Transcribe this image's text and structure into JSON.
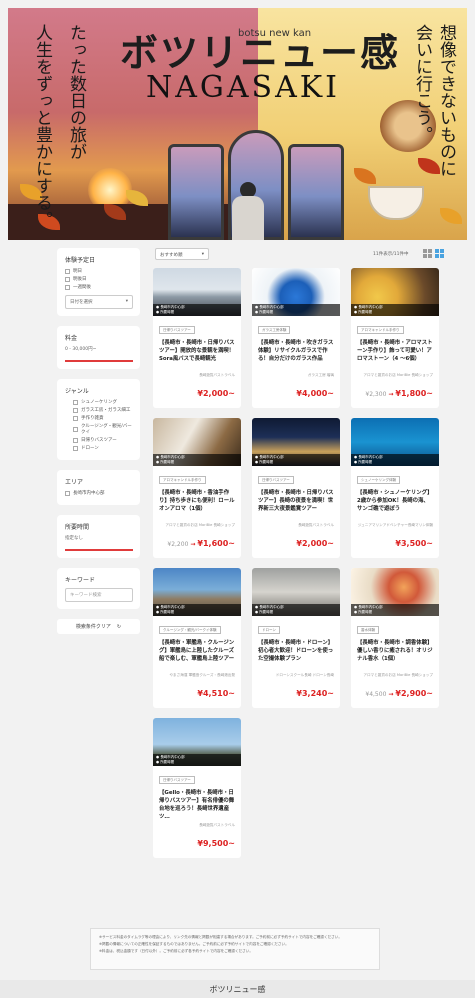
{
  "hero": {
    "logo_katakana": "ボツリニュー感",
    "logo_romaji": "botsu new kan",
    "city": "NAGASAKI",
    "tagline_left_1": "たった数日の旅が",
    "tagline_left_2": "人生をずっと豊かにする。",
    "tagline_right_1": "想像できないものに",
    "tagline_right_2": "会いに行こう。"
  },
  "sidebar": {
    "date": {
      "heading": "体験予定日",
      "options": [
        "明日",
        "明後日",
        "一週間後"
      ],
      "select_label": "日付を選択"
    },
    "price": {
      "heading": "料金",
      "range": "0 - 30,000円~"
    },
    "genre": {
      "heading": "ジャンル",
      "options": [
        "シュノーケリング",
        "ガラス工房・ガラス細工",
        "手作り雑貨",
        "クルージング・観光/バークイ",
        "日帰りバスツアー",
        "ドローン"
      ]
    },
    "area": {
      "heading": "エリア",
      "options": [
        "長崎市内中心部"
      ]
    },
    "duration": {
      "heading": "所要時間",
      "value": "指定なし"
    },
    "keyword": {
      "heading": "キーワード",
      "placeholder": "キーワード検索"
    },
    "clear_label": "検索条件クリア"
  },
  "toolbar": {
    "sort_label": "おすすめ順",
    "count_label": "11件表示/11件中"
  },
  "cards": [
    {
      "meta1": "長崎市内中心部",
      "meta2": "所要時間",
      "tag": "日帰りバスツアー",
      "name": "【長崎市・長崎市・日帰りバスツアー】開放的な景観を満喫！Sora風バスで長崎観光",
      "provider": "長崎遊覧バストラベル",
      "old_price": "",
      "price": "¥2,000~"
    },
    {
      "meta1": "長崎市内中心部",
      "meta2": "所要時間",
      "tag": "ガラス工房体験",
      "name": "【長崎市・長崎市・吹きガラス体験】リサイクルガラスで作る！自分だけのガラス作品",
      "provider": "ガラス工房 瑠璃",
      "old_price": "",
      "price": "¥4,000~"
    },
    {
      "meta1": "長崎市内中心部",
      "meta2": "所要時間",
      "tag": "アロマキャンドル手作り",
      "name": "【長崎市・長崎市・アロマストーン手作り】飾って可愛い！アロマストーン（4 ～6個）",
      "provider": "アロマと雑貨のお店 MoriBie 長崎ショップ",
      "old_price": "¥2,300",
      "price": "¥1,800~"
    },
    {
      "meta1": "長崎市内中心部",
      "meta2": "所要時間",
      "tag": "アロマキャンドル手作り",
      "name": "【長崎市・長崎市・香油手作り】持ち歩きにも便利！ロールオンアロマ（1個）",
      "provider": "アロマと雑貨のお店 MoriBie 長崎ショップ",
      "old_price": "¥2,200",
      "price": "¥1,600~"
    },
    {
      "meta1": "長崎市内中心部",
      "meta2": "所要時間",
      "tag": "日帰りバスツアー",
      "name": "【長崎市・長崎市・日帰りバスツアー】長崎の夜景を満喫！世界新三大夜景鑑賞ツアー",
      "provider": "長崎遊覧バストラベル",
      "old_price": "",
      "price": "¥2,000~"
    },
    {
      "meta1": "長崎市内中心部",
      "meta2": "所要時間",
      "tag": "シュノーケリング体験",
      "name": "【長崎市・シュノーケリング】2歳から参加OK！長崎の海、サンゴ礁で遊ぼう",
      "provider": "ジュニアマリンアドベンチャー長崎マリン体験",
      "old_price": "",
      "price": "¥3,500~"
    },
    {
      "meta1": "長崎市内中心部",
      "meta2": "所要時間",
      "tag": "クルージング・観光/バークイ体験",
      "name": "【長崎市・軍艦島・クルージング】軍艦島に上陸したクルーズ船で楽しむ、軍艦島上陸ツアー",
      "provider": "やまさ海運 軍艦島クルーズ・長崎港出発",
      "old_price": "",
      "price": "¥4,510~"
    },
    {
      "meta1": "長崎市内中心部",
      "meta2": "所要時間",
      "tag": "ドローン",
      "name": "【長崎市・長崎市・ドローン】初心者大歓迎！ドローンを使った空撮体験プラン",
      "provider": "ドローンスクール長崎 ドローン長崎",
      "old_price": "",
      "price": "¥3,240~"
    },
    {
      "meta1": "長崎市内中心部",
      "meta2": "所要時間",
      "tag": "香水体験",
      "name": "【長崎市・長崎市・調香体験】優しい香りに癒される！オリジナル香水（1個）",
      "provider": "アロマと雑貨のお店 MoriBie 長崎ショップ",
      "old_price": "¥4,500",
      "price": "¥2,900~"
    },
    {
      "meta1": "長崎市内中心部",
      "meta2": "所要時間",
      "tag": "日帰りバスツアー",
      "name": "【Gello・長崎市・長崎市・日帰りバスツアー】有名俳優の舞台地を巡ろう！長崎世界遺産ツ…",
      "provider": "長崎遊覧バストラベル",
      "old_price": "",
      "price": "¥9,500~"
    }
  ],
  "notice": {
    "line1": "※サービス料金のタイムラグ等の理由により、リンク先の情報と掲載が相違する場合があります。ご予約前に必ず予約サイトで内容をご確認ください。",
    "line2": "※掲載の情報についての正確性を保証するものではありません。ご予約前に必ず予約サイトで内容をご確認ください。",
    "line3": "※料金は、税込金額です（日付以外）。ご予約前に必ず各予約サイトで内容をご確認ください。"
  },
  "footer": {
    "logo": "ボツリニュー感"
  },
  "colors": {
    "accent_red": "#e03b3b",
    "price_red": "#dd2222",
    "view_active": "#4aa3e0"
  }
}
